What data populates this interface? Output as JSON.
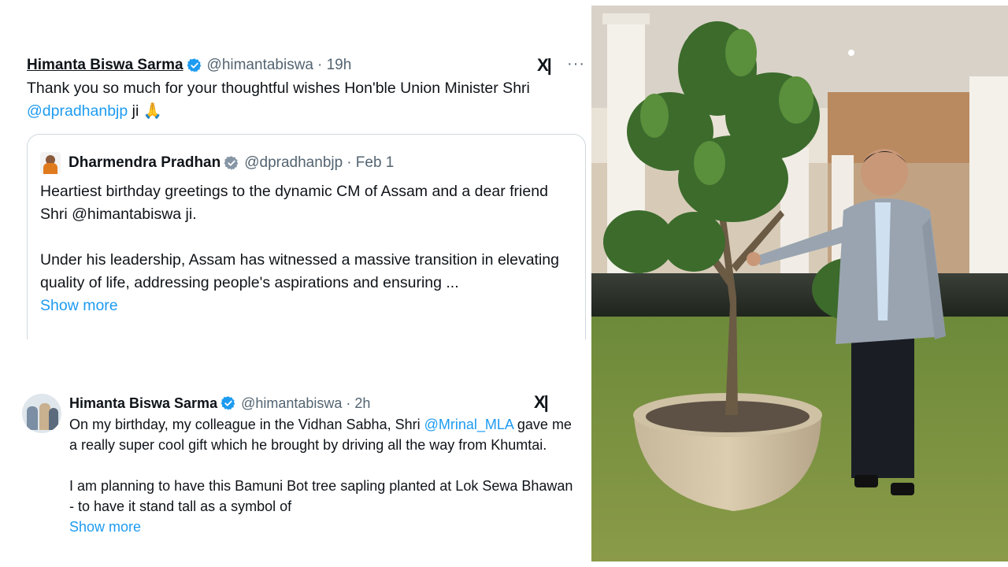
{
  "tweet_top": {
    "author_name": "Himanta Biswa Sarma",
    "handle": "@himantabiswa",
    "time": "· 19h",
    "text_before": "Thank you so much for your thoughtful wishes Hon'ble Union Minister Shri ",
    "mention": "@dpradhanbjp",
    "text_after": " ji 🙏",
    "x_logo": "X|",
    "more": "···",
    "quoted": {
      "author_name": "Dharmendra Pradhan",
      "handle": "@dpradhanbjp",
      "time": "· Feb 1",
      "paragraph_1": "Heartiest birthday greetings to the dynamic CM of Assam and a dear friend Shri @himantabiswa ji.",
      "paragraph_2": "Under his leadership, Assam has witnessed a massive transition in elevating quality of life, addressing people's aspirations and ensuring ...",
      "show_more": "Show more"
    }
  },
  "tweet_bottom": {
    "author_name": "Himanta Biswa Sarma",
    "handle": "@himantabiswa",
    "time": "· 2h",
    "x_logo": "X|",
    "text_before": "On my birthday, my colleague in the Vidhan Sabha, Shri ",
    "mention": "@Mrinal_MLA",
    "text_after": " gave me a really super cool gift which he brought by driving all the way from Khumtai.",
    "paragraph_2": "I am planning to have this Bamuni Bot tree sapling planted at Lok Sewa Bhawan - to have it stand tall as a symbol of",
    "show_more": "Show more"
  },
  "colors": {
    "link": "#1d9bf0",
    "verified": "#1d9bf0",
    "secondary_text": "#536471"
  }
}
